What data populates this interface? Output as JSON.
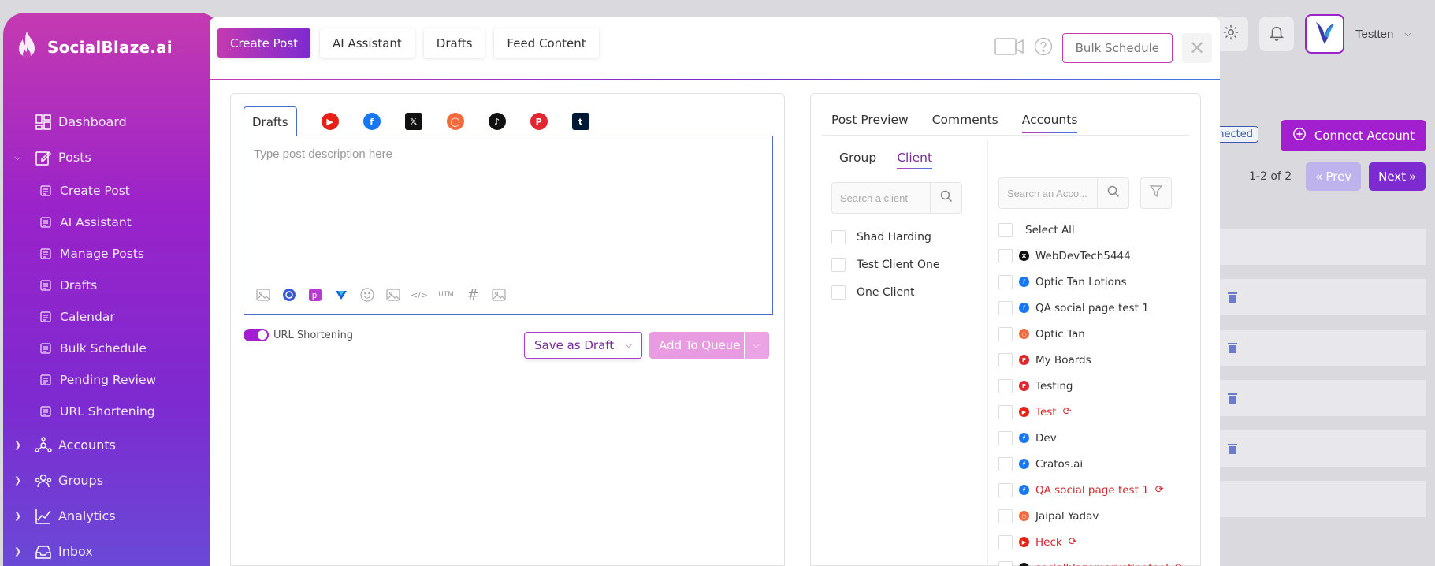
{
  "app": {
    "brand": "SocialBlaze.ai",
    "user_name": "Testten"
  },
  "sidebar": {
    "items": [
      {
        "label": "Dashboard",
        "icon": "dashboard-icon",
        "level": "top",
        "chevron": ""
      },
      {
        "label": "Posts",
        "icon": "edit-icon",
        "level": "top",
        "chevron": "expanded"
      },
      {
        "label": "Create Post",
        "icon": "create-post-icon",
        "level": "sub",
        "chevron": ""
      },
      {
        "label": "AI Assistant",
        "icon": "ai-icon",
        "level": "sub",
        "chevron": ""
      },
      {
        "label": "Manage Posts",
        "icon": "manage-icon",
        "level": "sub",
        "chevron": ""
      },
      {
        "label": "Drafts",
        "icon": "drafts-icon",
        "level": "sub",
        "chevron": ""
      },
      {
        "label": "Calendar",
        "icon": "calendar-icon",
        "level": "sub",
        "chevron": ""
      },
      {
        "label": "Bulk Schedule",
        "icon": "bulk-calendar-icon",
        "level": "sub",
        "chevron": ""
      },
      {
        "label": "Pending Review",
        "icon": "review-icon",
        "level": "sub",
        "chevron": ""
      },
      {
        "label": "URL Shortening",
        "icon": "link-icon",
        "level": "sub",
        "chevron": ""
      },
      {
        "label": "Accounts",
        "icon": "network-icon",
        "level": "top",
        "chevron": "collapsed"
      },
      {
        "label": "Groups",
        "icon": "groups-icon",
        "level": "top",
        "chevron": "collapsed"
      },
      {
        "label": "Analytics",
        "icon": "analytics-icon",
        "level": "top",
        "chevron": "collapsed"
      },
      {
        "label": "Inbox",
        "icon": "inbox-icon",
        "level": "top",
        "chevron": "collapsed"
      }
    ]
  },
  "background_page": {
    "badge": "nnected",
    "connect_label": "Connect Account",
    "pagination": {
      "summary": "1-2 of 2",
      "prev": "Prev",
      "next": "Next"
    }
  },
  "modal": {
    "tabs": [
      "Create Post",
      "AI Assistant",
      "Drafts",
      "Feed Content"
    ],
    "bulk_schedule": "Bulk Schedule",
    "editor": {
      "drafts_tab": "Drafts",
      "networks": [
        "youtube",
        "facebook",
        "x",
        "instagram",
        "tiktok",
        "pinterest",
        "tumblr"
      ],
      "placeholder": "Type post description here",
      "tools": [
        "media-icon",
        "canva-icon",
        "picsart-icon",
        "vista-icon",
        "emoji-icon",
        "gif-icon",
        "code-icon",
        "utm-icon",
        "hashtag-icon",
        "gallery-icon"
      ],
      "utm_text": "UTM",
      "url_shortening_label": "URL Shortening",
      "url_shortening_on": true,
      "save_draft": "Save as Draft",
      "add_to_queue": "Add To Queue"
    },
    "right": {
      "tabs": [
        "Post Preview",
        "Comments",
        "Accounts"
      ],
      "active_tab": "Accounts",
      "subtabs": [
        "Group",
        "Client"
      ],
      "client_search_placeholder": "Search a client",
      "account_search_placeholder": "Search an Acco...",
      "clients": [
        "Shad Harding",
        "Test Client One",
        "One Client"
      ],
      "select_all": "Select All",
      "accounts": [
        {
          "name": "WebDevTech5444",
          "network": "x",
          "error": false
        },
        {
          "name": "Optic Tan Lotions",
          "network": "facebook",
          "error": false
        },
        {
          "name": "QA social page test 1",
          "network": "facebook",
          "error": false
        },
        {
          "name": "Optic Tan",
          "network": "instagram",
          "error": false
        },
        {
          "name": "My Boards",
          "network": "pinterest",
          "error": false
        },
        {
          "name": "Testing",
          "network": "pinterest",
          "error": false
        },
        {
          "name": "Test",
          "network": "youtube",
          "error": true
        },
        {
          "name": "Dev",
          "network": "facebook",
          "error": false
        },
        {
          "name": "Cratos.ai",
          "network": "facebook",
          "error": false
        },
        {
          "name": "QA social page test 1",
          "network": "facebook",
          "error": true
        },
        {
          "name": "Jaipal Yadav",
          "network": "instagram",
          "error": false
        },
        {
          "name": "Heck",
          "network": "youtube",
          "error": true
        },
        {
          "name": "socialblazemarketingtool",
          "network": "tiktok",
          "error": true
        }
      ]
    }
  },
  "colors": {
    "brand_gradient_start": "#c43ab0",
    "brand_purple": "#a21fd0",
    "error_red": "#d8262e",
    "youtube": "#e62117",
    "facebook": "#1877f2",
    "x": "#111111",
    "instagram": "#f26a3d",
    "tiktok": "#111111",
    "pinterest": "#e1262f",
    "tumblr": "#001935"
  }
}
